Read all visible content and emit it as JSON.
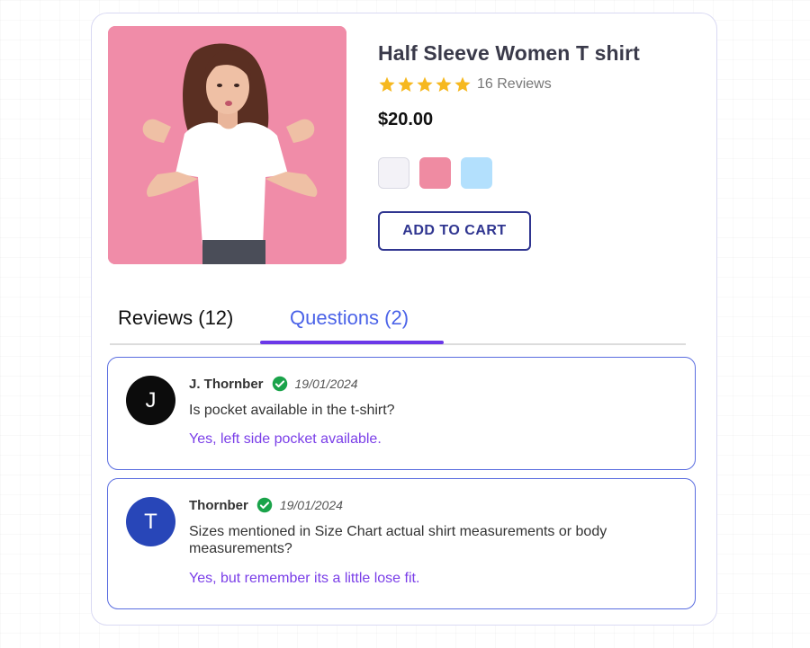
{
  "product": {
    "title": "Half Sleeve Women T shirt",
    "rating": 5,
    "review_count_text": "16 Reviews",
    "price": "$20.00",
    "swatches": [
      {
        "name": "white",
        "color": "#f3f2f7"
      },
      {
        "name": "pink",
        "color": "#ef8ba2"
      },
      {
        "name": "light-blue",
        "color": "#b3e0fd"
      }
    ],
    "add_to_cart_label": "ADD TO CART",
    "star_color": "#f6b81f"
  },
  "tabs": {
    "reviews": "Reviews (12)",
    "questions": "Questions (2)",
    "active": "questions"
  },
  "questions": [
    {
      "initial": "J",
      "avatar_color": "#0c0c0c",
      "author": "J. Thornber",
      "date": "19/01/2024",
      "question": "Is pocket available in the t-shirt?",
      "answer": "Yes, left side pocket available."
    },
    {
      "initial": "T",
      "avatar_color": "#2846b8",
      "author": "Thornber",
      "date": "19/01/2024",
      "question": "Sizes mentioned in Size Chart actual shirt measurements or body measurements?",
      "answer": "Yes, but remember its a little lose fit."
    }
  ],
  "colors": {
    "accent": "#4b63e8",
    "tab_indicator": "#6b38e8",
    "answer_text": "#7a3ee8",
    "verified": "#1aa34a",
    "cart_border": "#2f3590"
  }
}
